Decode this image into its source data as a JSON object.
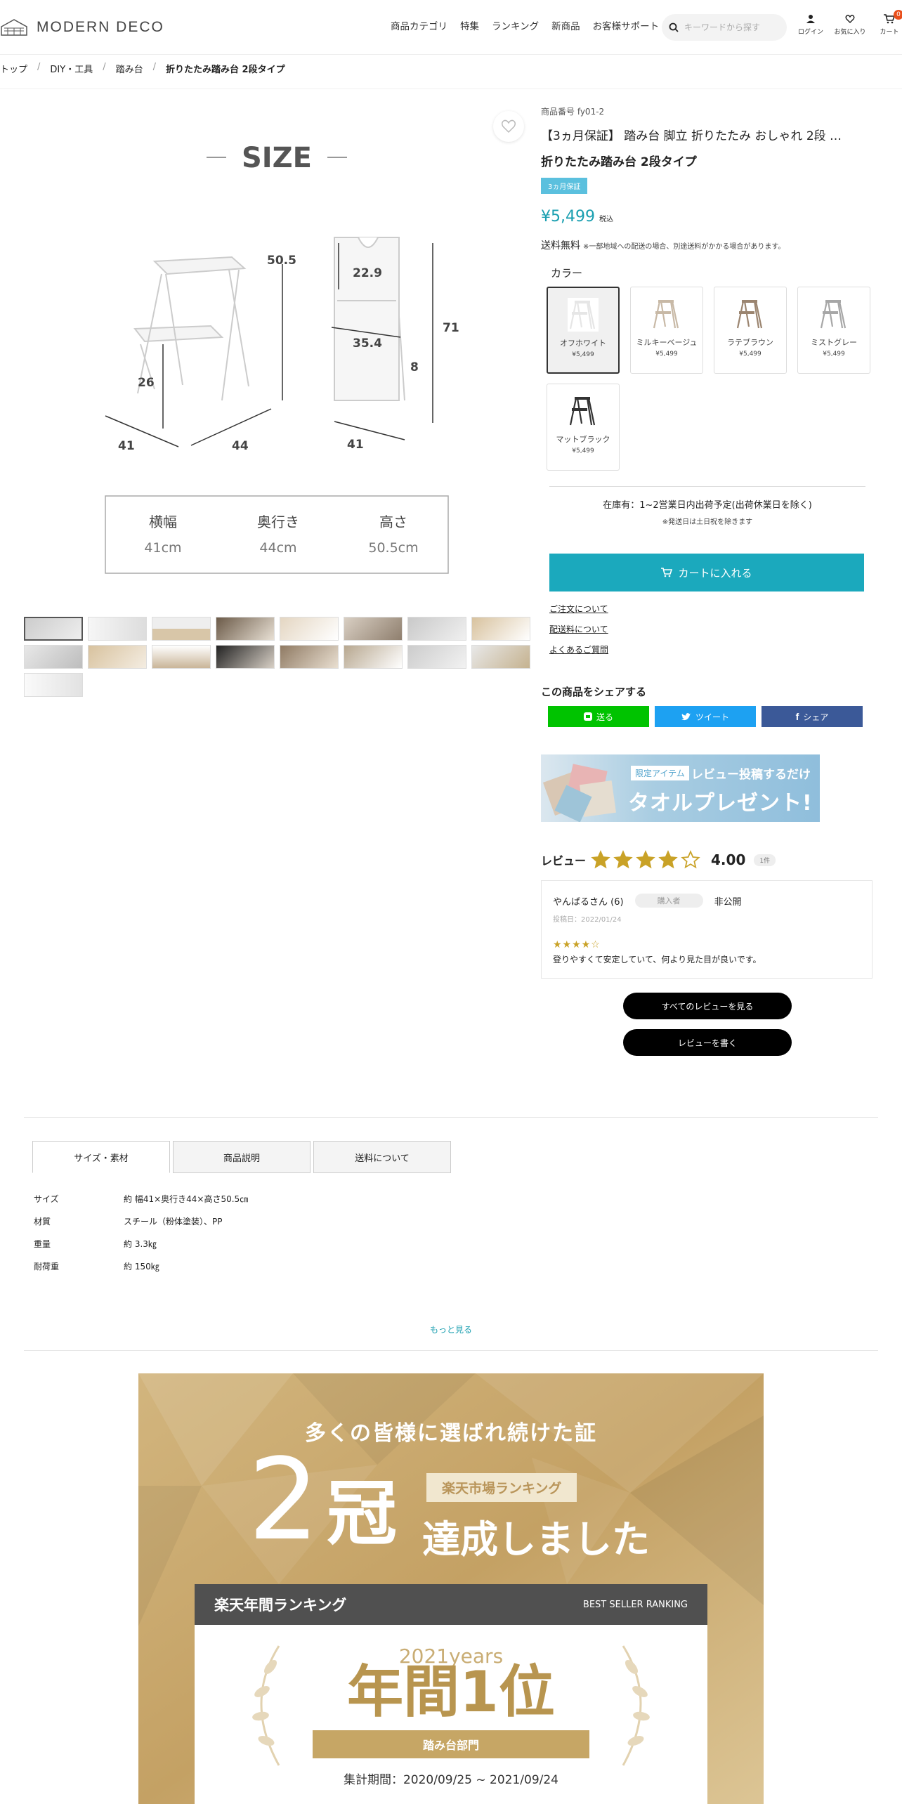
{
  "header": {
    "logo_text": "MODERN DECO",
    "nav": [
      "商品カテゴリ",
      "特集",
      "ランキング",
      "新商品",
      "お客様サポート"
    ],
    "search_placeholder": "キーワードから探す",
    "icons": [
      {
        "icon": "user-icon",
        "label": "ログイン"
      },
      {
        "icon": "heart-icon",
        "label": "お気に入り"
      },
      {
        "icon": "cart-icon",
        "label": "カート"
      }
    ],
    "cart_count": "0"
  },
  "breadcrumb": [
    "トップ",
    "DIY・工具",
    "踏み台",
    "折りたたみ踏み台 2段タイプ"
  ],
  "breadcrumb_sep": "/",
  "main_image": {
    "heading": "SIZE",
    "dims": {
      "h_stool": "50.5",
      "step": "26",
      "w": "41",
      "d": "44",
      "top_gap": "22.9",
      "folded_w": "35.4",
      "folded_d": "8",
      "folded_h": "71",
      "folded_base": "41"
    },
    "table": [
      {
        "label": "横幅",
        "value": "41cm"
      },
      {
        "label": "奥行き",
        "value": "44cm"
      },
      {
        "label": "高さ",
        "value": "50.5cm"
      }
    ]
  },
  "product": {
    "sku": "商品番号 fy01-2",
    "title1": "【3ヵ月保証】 踏み台 脚立 折りたたみ おしゃれ 2段 …",
    "title2": "折りたたみ踏み台 2段タイプ",
    "badge": "3ヵ月保証",
    "price": "¥5,499",
    "tax": "税込",
    "shipping": "送料無料",
    "shipping_note": "※一部地域への配送の場合、別途送料がかかる場合があります。"
  },
  "color": {
    "label": "カラー",
    "options": [
      {
        "name": "オフホワイト",
        "price": "¥5,499",
        "tone": "#e6e6e6"
      },
      {
        "name": "ミルキーベージュ",
        "price": "¥5,499",
        "tone": "#c8b9a6"
      },
      {
        "name": "ラテブラウン",
        "price": "¥5,499",
        "tone": "#9b8570"
      },
      {
        "name": "ミストグレー",
        "price": "¥5,499",
        "tone": "#a7a7a7"
      },
      {
        "name": "マットブラック",
        "price": "¥5,499",
        "tone": "#333333"
      }
    ]
  },
  "stock": {
    "text": "在庫有：1~2営業日内出荷予定(出荷休業日を除く)",
    "note": "※発送日は土日祝を除きます"
  },
  "cart_button": "カートに入れる",
  "links": [
    "ご注文について",
    "配送料について",
    "よくあるご質問"
  ],
  "share": {
    "title": "この商品をシェアする",
    "line": "送る",
    "twitter": "ツイート",
    "facebook": "シェア"
  },
  "promo": {
    "tag": "限定アイテム",
    "line1": "レビュー投稿するだけ",
    "line2": "タオルプレゼント!"
  },
  "review": {
    "label": "レビュー",
    "score": "4.00",
    "rating": 4,
    "count": "1件",
    "item": {
      "name": "やんばるさん (6)",
      "buyer": "購入者",
      "visibility": "非公開",
      "date": "投稿日：2022/01/24",
      "stars": "★★★★☆",
      "body": "登りやすくて安定していて、何より見た目が良いです。"
    },
    "all_button": "すべてのレビューを見る",
    "write_button": "レビューを書く"
  },
  "tabs": [
    "サイズ・素材",
    "商品説明",
    "送料について"
  ],
  "spec": [
    {
      "k": "サイズ",
      "v": "約 幅41×奥行き44×高さ50.5㎝"
    },
    {
      "k": "材質",
      "v": "スチール（粉体塗装）、PP"
    },
    {
      "k": "重量",
      "v": "約 3.3㎏"
    },
    {
      "k": "耐荷重",
      "v": "約 150㎏"
    }
  ],
  "more": "もっと見る",
  "banner": {
    "lead": "多くの皆様に選ばれ続けた証",
    "num": "2",
    "kan": "冠",
    "ranking": "楽天市場ランキング",
    "done": "達成しました",
    "bar_title": "楽天年間ランキング",
    "bar_sub": "BEST SELLER RANKING",
    "year": "2021years",
    "big": "年間1位",
    "category": "踏み台部門",
    "period": "集計期間：2020/09/25 ~ 2021/09/24"
  }
}
